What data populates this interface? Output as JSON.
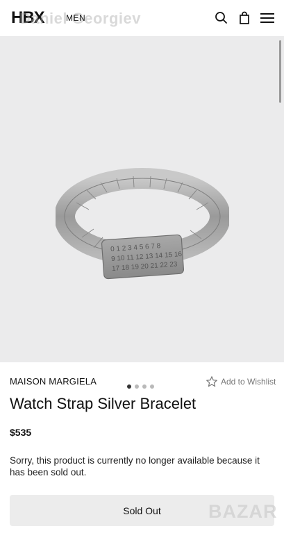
{
  "header": {
    "logo_text": "HBX",
    "watermark_text": "Daniel Georgiev",
    "gender_label": "MEN",
    "icons": [
      "search-icon",
      "shopping-bag-icon",
      "hamburger-menu-icon"
    ]
  },
  "gallery": {
    "image_name": "watch-strap-silver-bracelet",
    "dots_total": 4,
    "dots_active": 1
  },
  "product": {
    "brand": "MAISON MARGIELA",
    "wishlist_label": "Add to Wishlist",
    "title": "Watch Strap Silver Bracelet",
    "price": "$535",
    "notice": "Sorry, this product is currently no longer available because it has been sold out.",
    "button_label": "Sold Out"
  },
  "watermark_stamp": "BAZAR",
  "colors": {
    "background": "#ffffff",
    "gallery_bg": "#ebebec",
    "text": "#111111",
    "muted": "#777777",
    "button_bg": "#ececec"
  }
}
